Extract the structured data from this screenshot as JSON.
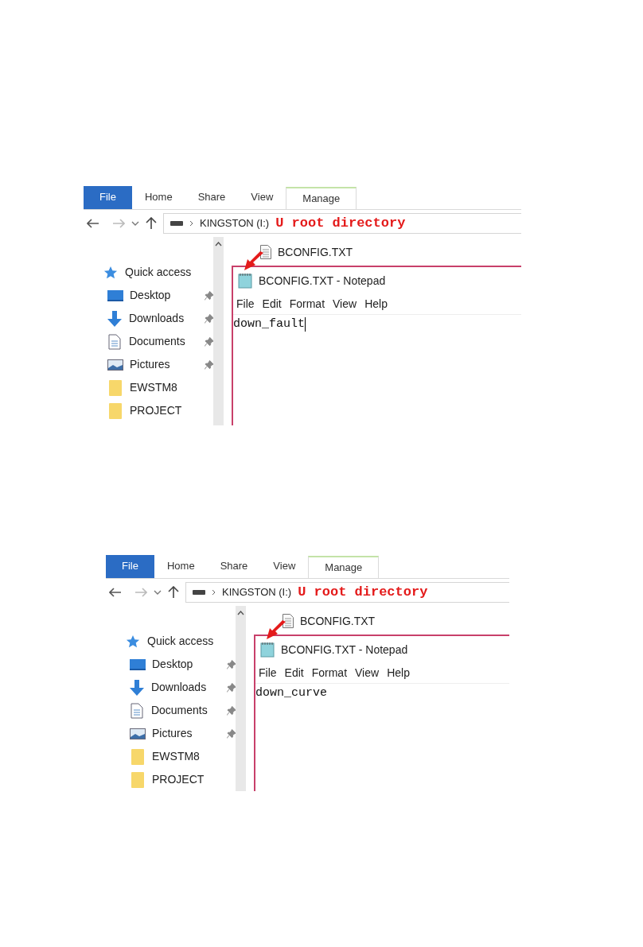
{
  "screenshots": [
    {
      "ribbon_tabs": [
        {
          "label": "File",
          "kind": "file"
        },
        {
          "label": "Home",
          "kind": "plain"
        },
        {
          "label": "Share",
          "kind": "plain"
        },
        {
          "label": "View",
          "kind": "plain"
        },
        {
          "label": "Manage",
          "kind": "contextual"
        }
      ],
      "address": {
        "path": "KINGSTON (I:)",
        "annotation": "U root directory"
      },
      "nav_items": [
        {
          "label": "Quick access",
          "kind": "star",
          "pinned": false
        },
        {
          "label": "Desktop",
          "kind": "desktop",
          "pinned": true
        },
        {
          "label": "Downloads",
          "kind": "download",
          "pinned": true
        },
        {
          "label": "Documents",
          "kind": "document",
          "pinned": true
        },
        {
          "label": "Pictures",
          "kind": "pictures",
          "pinned": true
        },
        {
          "label": "EWSTM8",
          "kind": "folder",
          "pinned": false
        },
        {
          "label": "PROJECT",
          "kind": "folder",
          "pinned": false
        }
      ],
      "file": "BCONFIG.TXT",
      "notepad": {
        "title": "BCONFIG.TXT - Notepad",
        "menu": [
          "File",
          "Edit",
          "Format",
          "View",
          "Help"
        ],
        "content": "down_fault",
        "caret": true
      }
    },
    {
      "ribbon_tabs": [
        {
          "label": "File",
          "kind": "file"
        },
        {
          "label": "Home",
          "kind": "plain"
        },
        {
          "label": "Share",
          "kind": "plain"
        },
        {
          "label": "View",
          "kind": "plain"
        },
        {
          "label": "Manage",
          "kind": "contextual"
        }
      ],
      "address": {
        "path": "KINGSTON (I:)",
        "annotation": "U root directory"
      },
      "nav_items": [
        {
          "label": "Quick access",
          "kind": "star",
          "pinned": false
        },
        {
          "label": "Desktop",
          "kind": "desktop",
          "pinned": true
        },
        {
          "label": "Downloads",
          "kind": "download",
          "pinned": true
        },
        {
          "label": "Documents",
          "kind": "document",
          "pinned": true
        },
        {
          "label": "Pictures",
          "kind": "pictures",
          "pinned": true
        },
        {
          "label": "EWSTM8",
          "kind": "folder",
          "pinned": false
        },
        {
          "label": "PROJECT",
          "kind": "folder",
          "pinned": false
        }
      ],
      "file": "BCONFIG.TXT",
      "notepad": {
        "title": "BCONFIG.TXT - Notepad",
        "menu": [
          "File",
          "Edit",
          "Format",
          "View",
          "Help"
        ],
        "content": "down_curve",
        "caret": false
      }
    }
  ]
}
